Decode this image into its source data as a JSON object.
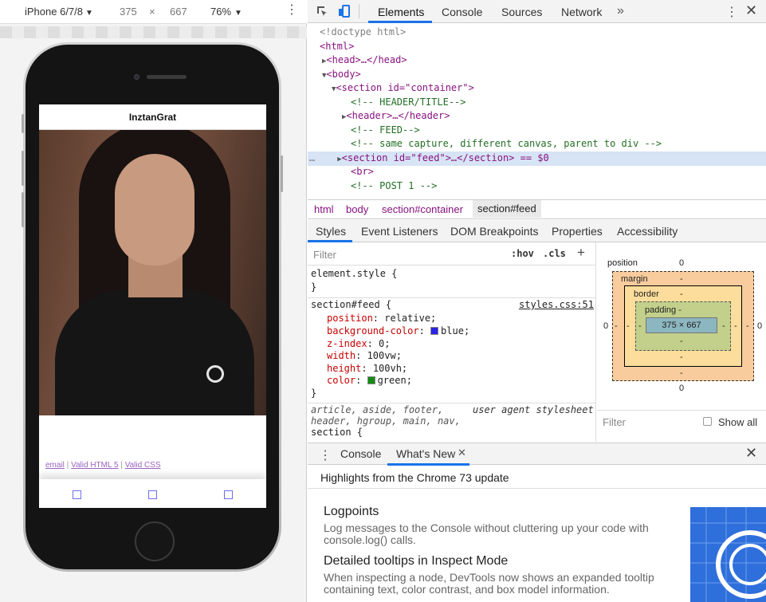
{
  "device_toolbar": {
    "device": "iPhone 6/7/8",
    "width": "375",
    "times": "×",
    "height": "667",
    "zoom": "76%"
  },
  "app": {
    "title": "InztanGrat",
    "footer_email": "email",
    "footer_sep1": " | ",
    "footer_html": "Valid HTML 5",
    "footer_sep2": " | ",
    "footer_css": "Valid CSS"
  },
  "devtools": {
    "tabs": [
      "Elements",
      "Console",
      "Sources",
      "Network"
    ],
    "dom_lines": [
      {
        "text": "<!doctype html>"
      },
      {
        "text": "<html>"
      },
      {
        "text": "<head>…</head>"
      },
      {
        "text": "<body>"
      },
      {
        "text": "<section id=\"container\">"
      },
      {
        "text": "<!-- HEADER/TITLE-->"
      },
      {
        "text": "<header>…</header>"
      },
      {
        "text": "<!-- FEED-->"
      },
      {
        "text": "<!-- same capture, different canvas, parent to div -->"
      },
      {
        "text": "<section id=\"feed\">…</section> == $0"
      },
      {
        "text": "<br>"
      },
      {
        "text": "<!-- POST 1 -->"
      }
    ],
    "breadcrumbs": [
      "html",
      "body",
      "section#container",
      "section#feed"
    ],
    "sub_tabs": [
      "Styles",
      "Event Listeners",
      "DOM Breakpoints",
      "Properties",
      "Accessibility"
    ],
    "styles": {
      "filter_placeholder": "Filter",
      "hov": ":hov",
      "cls": ".cls",
      "element_style": "element.style {",
      "close_brace": "}",
      "rule_selector": "section#feed {",
      "rule_source": "styles.css:51",
      "declarations": [
        {
          "prop": "position",
          "value": "relative;"
        },
        {
          "prop": "background-color",
          "value": "blue;",
          "swatch": "#2b24e6"
        },
        {
          "prop": "z-index",
          "value": "0;"
        },
        {
          "prop": "width",
          "value": "100vw;"
        },
        {
          "prop": "height",
          "value": "100vh;"
        },
        {
          "prop": "color",
          "value": "green;",
          "swatch": "#138a13"
        }
      ],
      "ua_selector_line1": "article, aside, footer,",
      "ua_selector_line2": "header, hgroup, main, nav,",
      "ua_selector_line3": "section {",
      "ua_label": "user agent stylesheet"
    },
    "box_model": {
      "position_label": "position",
      "position_value": "0",
      "margin_label": "margin",
      "margin_value": "-",
      "border_label": "border",
      "border_value": "-",
      "padding_label": "padding -",
      "content": "375 × 667",
      "side_value": "0",
      "dash": "-",
      "bottom_position": "0",
      "filter_placeholder": "Filter",
      "show_all": "Show all"
    },
    "drawer": {
      "tabs": [
        "Console",
        "What's New"
      ],
      "headline": "Highlights from the Chrome 73 update",
      "items": [
        {
          "title": "Logpoints",
          "body": "Log messages to the Console without cluttering up your code with console.log() calls."
        },
        {
          "title": "Detailed tooltips in Inspect Mode",
          "body": "When inspecting a node, DevTools now shows an expanded tooltip containing text, color contrast, and box model information."
        }
      ]
    }
  }
}
